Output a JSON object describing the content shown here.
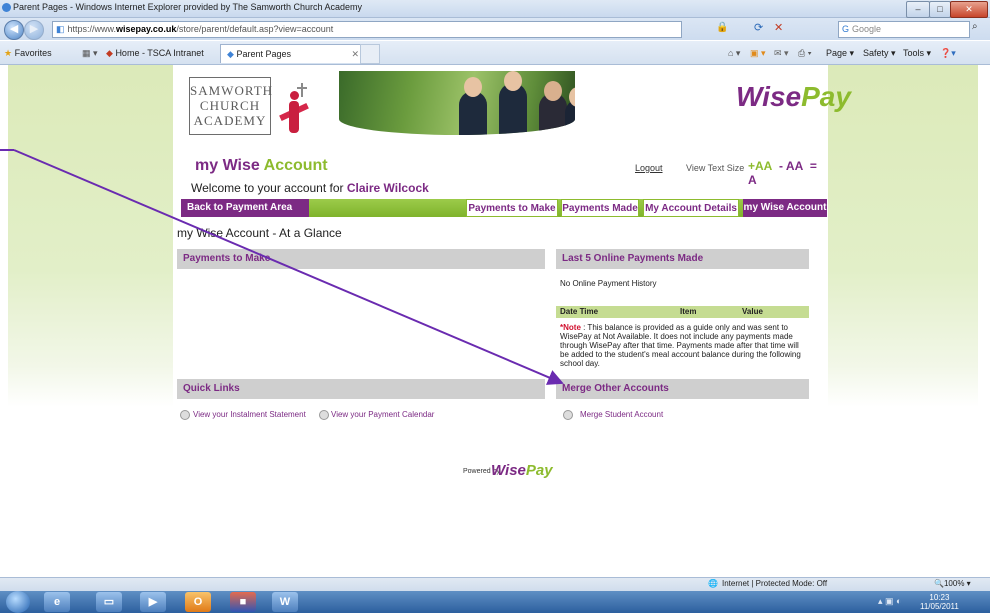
{
  "window": {
    "title": "Parent Pages - Windows Internet Explorer provided by The Samworth Church Academy"
  },
  "browser": {
    "url_prefix": "https://www.",
    "url_host": "wisepay.co.uk",
    "url_path": "/store/parent/default.asp?view=account",
    "search_placeholder": "Google",
    "favorites_label": "Favorites",
    "tabs": [
      {
        "label": "Home - TSCA Intranet"
      },
      {
        "label": "Parent Pages"
      }
    ],
    "toolbar": {
      "page": "Page ▾",
      "safety": "Safety ▾",
      "tools": "Tools ▾"
    }
  },
  "header": {
    "school_logo_lines": [
      "SAMWORTH",
      "CHURCH",
      "ACADEMY"
    ],
    "wisepay_logo": {
      "part1": "Wise",
      "part2": "Pay"
    }
  },
  "account": {
    "title_part1": "my ",
    "title_part2": "Wise",
    "title_part3": " Account",
    "welcome_prefix": "Welcome  to your account for ",
    "user_name": "Claire Wilcock",
    "logout": "Logout",
    "view_text_size": "View Text Size",
    "size_large": "+AA",
    "size_medium": "- AA",
    "size_small": "= A"
  },
  "nav": {
    "back": "Back to Payment Area",
    "payments_to_make": "Payments to Make",
    "payments_made": "Payments Made",
    "my_account_details": "My Account Details",
    "my_wise_account": "my Wise Account"
  },
  "main": {
    "heading": "my Wise Account - At a Glance",
    "payments_to_make": {
      "title": "Payments to Make"
    },
    "last_payments": {
      "title": "Last 5 Online Payments Made",
      "empty": "No Online Payment History",
      "columns": [
        "Date Time",
        "Item",
        "Value"
      ],
      "note_label": "Note",
      "note_text": " : This balance is provided as a guide only and was sent to WisePay at Not Available. It does not include any payments made through WisePay after that time. Payments made after that time will be added to the student's meal account balance during the following school day."
    },
    "quick_links": {
      "title": "Quick Links",
      "links": [
        "View your Instalment Statement",
        "View your Payment Calendar"
      ]
    },
    "merge": {
      "title": "Merge Other Accounts",
      "link": "Merge Student Account"
    }
  },
  "footer": {
    "powered_by": "Powered by"
  },
  "statusbar": {
    "zone": "Internet | Protected Mode: Off",
    "zoom": "100%"
  },
  "taskbar": {
    "time": "10:23",
    "date": "11/05/2011"
  },
  "colors": {
    "purple": "#7c2a84",
    "green": "#8dbb2e",
    "annotation": "#6a2bb0"
  }
}
